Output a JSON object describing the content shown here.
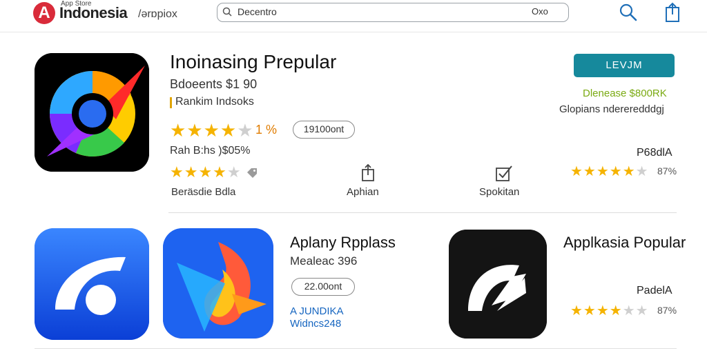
{
  "header": {
    "logo_letter": "A",
    "logo_small": "App Store",
    "logo_main": "Indonesia",
    "logo_sub": "/ərɒpiox",
    "search": {
      "value": "Decentro",
      "suffix": "Oxo"
    },
    "icons": [
      "search-icon",
      "share-icon"
    ]
  },
  "featured": {
    "title": "Inoinasing Prepular",
    "price": "Bdoeents $1 90",
    "rank": "Rankim Indsoks",
    "rating_stars": 4,
    "rating_count": "1 %",
    "pill": "19100ont",
    "subtitle": "Rah B:hs )$05%",
    "rating2_stars": 4,
    "footer_label": "Beräsdie Bdla",
    "actions": [
      {
        "label": "Aphian",
        "icon": "share-icon"
      },
      {
        "label": "Spokitan",
        "icon": "check-box-icon"
      }
    ],
    "install_label": "LEVJM",
    "discount": "Dlenease $800RK",
    "gloss": "Glopians ndereredddgj",
    "category": "P68dlA",
    "cat_stars": 4.5,
    "cat_pct": "87%"
  },
  "row2": {
    "title": "Aplany Rpplass",
    "subtitle": "Mealeac 396",
    "pill": "22.00ont",
    "link1": "A JUNDIKA",
    "link2": "Widncs248",
    "popular": {
      "title": "Applkasia Popular",
      "category": "PadelA",
      "stars": 4,
      "pct": "87%"
    }
  },
  "colors": {
    "accent": "#16899c",
    "star": "#f5b301",
    "discount": "#7aaa12",
    "link": "#1565c0",
    "logo": "#d92b3a"
  }
}
